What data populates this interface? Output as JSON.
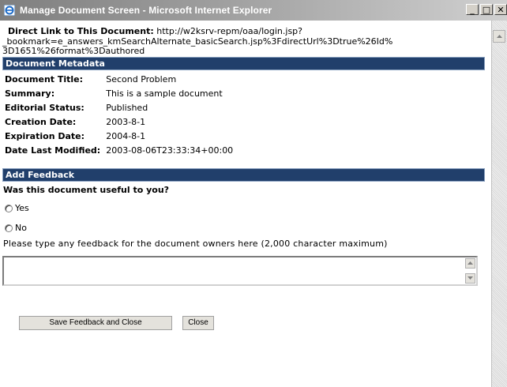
{
  "window": {
    "title": "Manage Document Screen - Microsoft Internet Explorer",
    "minimize_label": "_",
    "maximize_label": "□",
    "close_label": "✕"
  },
  "direct_link": {
    "label": "Direct Link to This Document:",
    "url_line1": "http://w2ksrv-repm/oaa/login.jsp?",
    "url_line2": "_bookmark=e_answers_kmSearchAlternate_basicSearch.jsp%3FdirectUrl%3Dtrue%26Id%",
    "url_line3": "3D1651%26format%3Dauthored"
  },
  "metadata": {
    "header": "Document Metadata",
    "rows": [
      {
        "key": "Document Title:",
        "value": "Second Problem"
      },
      {
        "key": "Summary:",
        "value": "This is a sample document"
      },
      {
        "key": "Editorial Status:",
        "value": "Published"
      },
      {
        "key": "Creation Date:",
        "value": "2003-8-1"
      },
      {
        "key": "Expiration Date:",
        "value": "2004-8-1"
      },
      {
        "key": "Date Last Modified:",
        "value": "2003-08-06T23:33:34+00:00"
      }
    ]
  },
  "feedback": {
    "header": "Add Feedback",
    "question": "Was this document useful to you?",
    "option_yes": "Yes",
    "option_no": "No",
    "instructions": "Please type any feedback for the document owners here (2,000 character maximum)",
    "textarea_value": "",
    "save_label": "Save Feedback and Close",
    "close_label": "Close"
  },
  "icons": {
    "window": "ie-icon",
    "scroll_up": "arrow-up-icon",
    "scroll_down": "arrow-down-icon"
  },
  "colors": {
    "section_header": "#213f6b"
  }
}
